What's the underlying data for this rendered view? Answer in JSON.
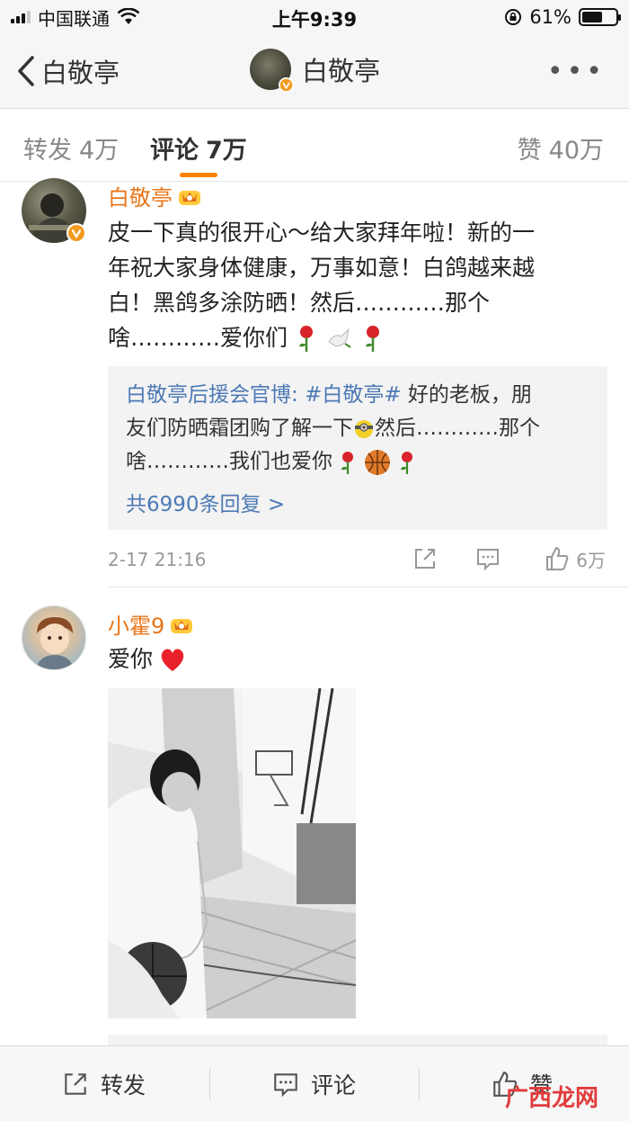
{
  "status_bar": {
    "carrier": "中国联通",
    "time": "上午9:39",
    "battery_text": "61%",
    "battery_level": 0.61
  },
  "nav": {
    "back_label": "白敬亭",
    "title": "白敬亭",
    "more_label": "•••"
  },
  "tabs": {
    "repost_label": "转发",
    "repost_count": "4万",
    "comment_label": "评论",
    "comment_count": "7万",
    "like_label": "赞",
    "like_count": "40万"
  },
  "comments": [
    {
      "username": "白敬亭",
      "text_lines": [
        "皮一下真的很开心～给大家拜年啦！新的一",
        "年祝大家身体健康，万事如意！白鸽越来越",
        "白！黑鸽多涂防晒！然后…………那个",
        "啥…………爱你们"
      ],
      "reply": {
        "author": "白敬亭后援会官博:",
        "hashtag": "#白敬亭#",
        "line1_rest": "好的老板，朋",
        "line2_before": "友们防晒霜团购了解一下",
        "line2_after": "然后…………那个",
        "line3": "啥…………我们也爱你",
        "more_label": "共6990条回复 >"
      },
      "time": "2-17 21:16",
      "like_count": "6万"
    },
    {
      "username": "小霍9",
      "text": "爱你"
    }
  ],
  "bottom_bar": {
    "repost_label": "转发",
    "comment_label": "评论",
    "like_label": "赞"
  },
  "watermark": "广西龙网",
  "colors": {
    "accent": "#ff8200",
    "username": "#e8761a",
    "link": "#4d7ab5"
  }
}
